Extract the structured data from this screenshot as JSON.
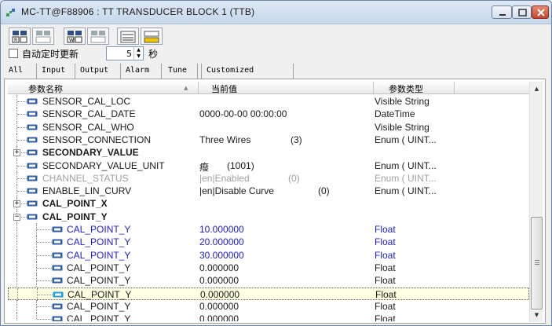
{
  "window": {
    "title": "MC-TT@F88906 : TT TRANSDUCER BLOCK 1 (TTB)"
  },
  "toolbar": {
    "buttons": [
      "read-selected-icon",
      "read-all-icon",
      "write-selected-icon",
      "write-all-icon",
      "hex-display-icon",
      "help-icon"
    ]
  },
  "auto_refresh": {
    "label": "自动定时更新",
    "interval": "5",
    "unit": "秒",
    "checked": false
  },
  "tabs": [
    {
      "label": "All",
      "active": true
    },
    {
      "label": "Input",
      "active": false
    },
    {
      "label": "Output",
      "active": false
    },
    {
      "label": "Alarm",
      "active": false
    },
    {
      "label": "Tune",
      "active": false
    },
    {
      "label": "Customized",
      "active": false
    }
  ],
  "columns": {
    "name": "参数名称",
    "value": "当前值",
    "type": "参数类型"
  },
  "rows": [
    {
      "name": "SENSOR_CAL_LOC",
      "value": "",
      "value2": "",
      "type": "Visible String",
      "style": "black",
      "level": 1
    },
    {
      "name": "SENSOR_CAL_DATE",
      "value": "0000-00-00 00:00:00",
      "value2": "",
      "type": "DateTime",
      "style": "black",
      "level": 1
    },
    {
      "name": "SENSOR_CAL_WHO",
      "value": "",
      "value2": "",
      "type": "Visible String",
      "style": "black",
      "level": 1
    },
    {
      "name": "SENSOR_CONNECTION",
      "value": "Three Wires",
      "value2": "(3)",
      "type": "Enum ( UINT...",
      "style": "black",
      "level": 1
    },
    {
      "name": "SECONDARY_VALUE",
      "value": "",
      "value2": "",
      "type": "",
      "style": "bold",
      "level": 1,
      "expander": "+"
    },
    {
      "name": "SECONDARY_VALUE_UNIT",
      "value": "癈",
      "value2": "(1001)",
      "type": "Enum ( UINT...",
      "style": "black",
      "level": 1
    },
    {
      "name": "CHANNEL_STATUS",
      "value": "|en|Enabled",
      "value2": "(0)",
      "type": "Enum ( UINT...",
      "style": "gray",
      "level": 1
    },
    {
      "name": "ENABLE_LIN_CURV",
      "value": "|en|Disable Curve",
      "value2": "(0)",
      "type": "Enum ( UINT...",
      "style": "black",
      "level": 1
    },
    {
      "name": "CAL_POINT_X",
      "value": "",
      "value2": "",
      "type": "",
      "style": "bold",
      "level": 1,
      "expander": "+"
    },
    {
      "name": "CAL_POINT_Y",
      "value": "",
      "value2": "",
      "type": "",
      "style": "bold",
      "level": 1,
      "expander": "-"
    },
    {
      "name": "CAL_POINT_Y",
      "value": "10.000000",
      "value2": "",
      "type": "Float",
      "style": "blue",
      "level": 2
    },
    {
      "name": "CAL_POINT_Y",
      "value": "20.000000",
      "value2": "",
      "type": "Float",
      "style": "blue",
      "level": 2
    },
    {
      "name": "CAL_POINT_Y",
      "value": "30.000000",
      "value2": "",
      "type": "Float",
      "style": "blue",
      "level": 2
    },
    {
      "name": "CAL_POINT_Y",
      "value": "0.000000",
      "value2": "",
      "type": "Float",
      "style": "black",
      "level": 2
    },
    {
      "name": "CAL_POINT_Y",
      "value": "0.000000",
      "value2": "",
      "type": "Float",
      "style": "black",
      "level": 2
    },
    {
      "name": "CAL_POINT_Y",
      "value": "0.000000",
      "value2": "",
      "type": "Float",
      "style": "black",
      "level": 2,
      "selected": true
    },
    {
      "name": "CAL_POINT_Y",
      "value": "0.000000",
      "value2": "",
      "type": "Float",
      "style": "black",
      "level": 2
    },
    {
      "name": "CAL_POINT_Y",
      "value": "0.000000",
      "value2": "",
      "type": "Float",
      "style": "black",
      "level": 2
    }
  ],
  "colors": {
    "param_icon": "#2f5fa8",
    "param_icon_selected": "#1aa0e0",
    "blue_text": "#1a1adc",
    "gray_text": "#a0a0a0",
    "selection": "#ffffe1"
  }
}
